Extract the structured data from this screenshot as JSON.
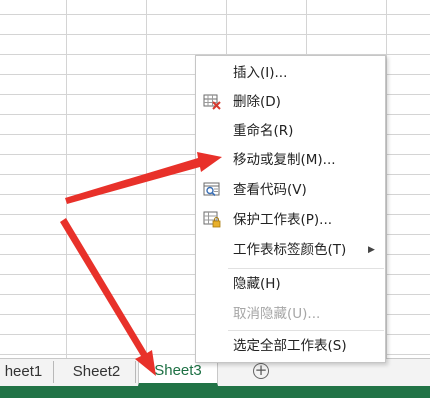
{
  "sheet_tabs": [
    {
      "label": "heet1",
      "active": false
    },
    {
      "label": "Sheet2",
      "active": false
    },
    {
      "label": "Sheet3",
      "active": true
    }
  ],
  "add_sheet_symbol": "+",
  "context_menu": {
    "items": [
      {
        "label": "插入(I)...",
        "icon": null,
        "enabled": true
      },
      {
        "label": "删除(D)",
        "icon": "delete-sheet-icon",
        "enabled": true
      },
      {
        "label": "重命名(R)",
        "icon": null,
        "enabled": true
      },
      {
        "label": "移动或复制(M)...",
        "icon": null,
        "enabled": true
      },
      {
        "label": "查看代码(V)",
        "icon": "view-code-icon",
        "enabled": true
      },
      {
        "label": "保护工作表(P)...",
        "icon": "protect-sheet-icon",
        "enabled": true
      },
      {
        "label": "工作表标签颜色(T)",
        "icon": null,
        "enabled": true,
        "submenu_glyph": "▶"
      },
      {
        "label": "隐藏(H)",
        "icon": null,
        "enabled": true
      },
      {
        "label": "取消隐藏(U)...",
        "icon": null,
        "enabled": false
      },
      {
        "label": "选定全部工作表(S)",
        "icon": null,
        "enabled": true
      }
    ]
  },
  "colors": {
    "accent_green": "#217346",
    "annotation_red": "#e8312a"
  }
}
